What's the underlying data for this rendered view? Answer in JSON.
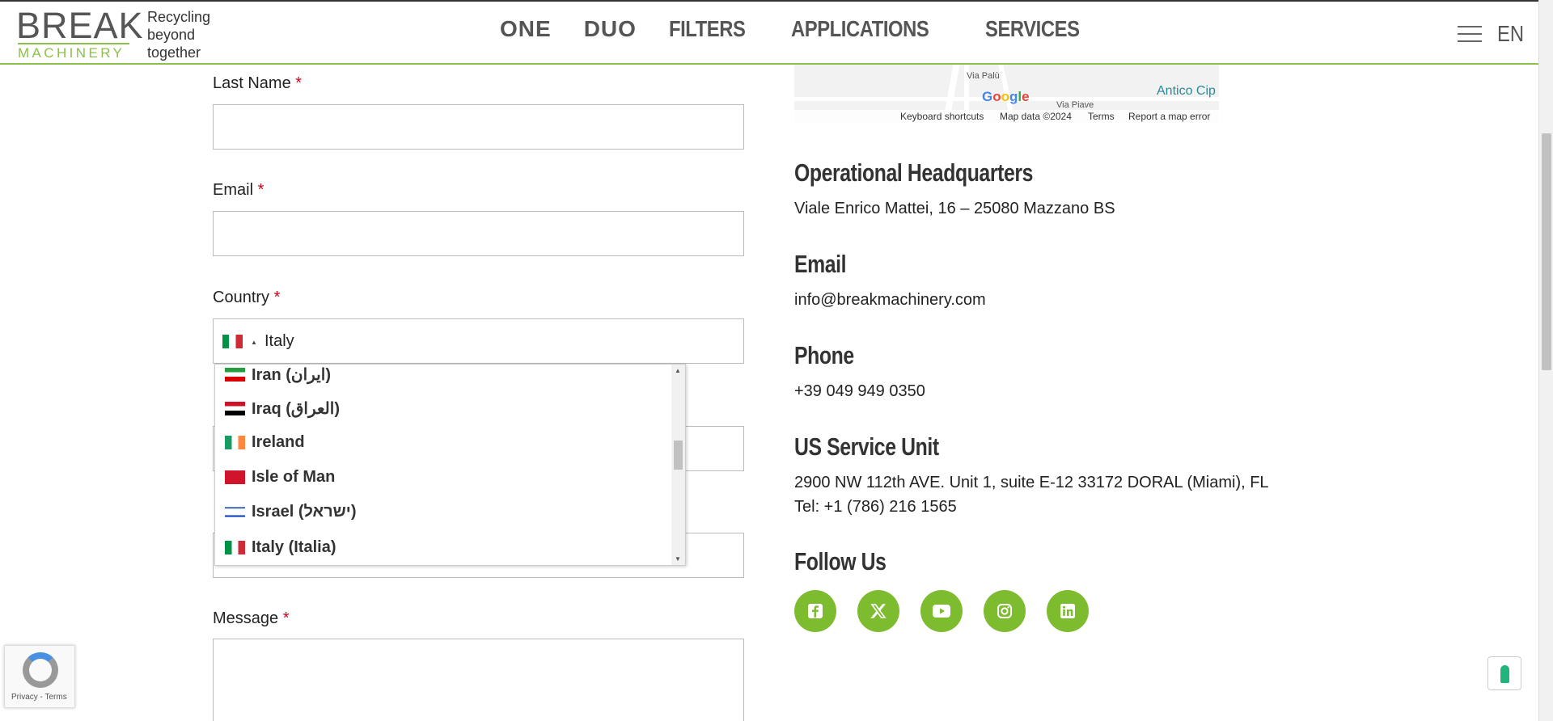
{
  "header": {
    "logo_main": "BREAK",
    "logo_sub": "MACHINERY",
    "tagline": [
      "Recycling",
      "beyond",
      "together"
    ],
    "nav": [
      "ONE",
      "DUO",
      "FILTERS",
      "APPLICATIONS",
      "SERVICES"
    ],
    "lang": "EN"
  },
  "form": {
    "last_name_label": "Last Name",
    "email_label": "Email",
    "country_label": "Country",
    "message_label": "Message",
    "required_mark": "*",
    "country_value": "Italy",
    "country_options": [
      {
        "label": "Iran (‫ایران‬‎)",
        "flag": "ir"
      },
      {
        "label": "Iraq (‫العراق‬‎)",
        "flag": "iq"
      },
      {
        "label": "Ireland",
        "flag": "ie"
      },
      {
        "label": "Isle of Man",
        "flag": "im"
      },
      {
        "label": "Israel (‫ישראל‬‎)",
        "flag": "il"
      },
      {
        "label": "Italy (Italia)",
        "flag": "it"
      }
    ]
  },
  "map": {
    "street1": "Via Palù",
    "street2": "Via Piave",
    "place": "Antico Cip",
    "google": "Google",
    "shortcuts": "Keyboard shortcuts",
    "map_data": "Map data ©2024",
    "terms": "Terms",
    "report": "Report a map error"
  },
  "contact": {
    "hq_title": "Operational Headquarters",
    "hq_address": "Viale Enrico Mattei, 16 – 25080 Mazzano BS",
    "email_title": "Email",
    "email_value": "info@breakmachinery.com",
    "phone_title": "Phone",
    "phone_value": "+39 049 949 0350",
    "us_title": "US Service Unit",
    "us_address": "2900 NW 112th AVE. Unit 1, suite E-12 33172 DORAL (Miami), FL",
    "us_tel": "Tel: +1 (786) 216 1565",
    "follow_title": "Follow Us"
  },
  "social": [
    "facebook-icon",
    "x-icon",
    "youtube-icon",
    "instagram-icon",
    "linkedin-icon"
  ],
  "recaptcha": {
    "text": "Privacy - Terms"
  },
  "colors": {
    "accent": "#7dbb2f",
    "required": "#d0021b"
  }
}
